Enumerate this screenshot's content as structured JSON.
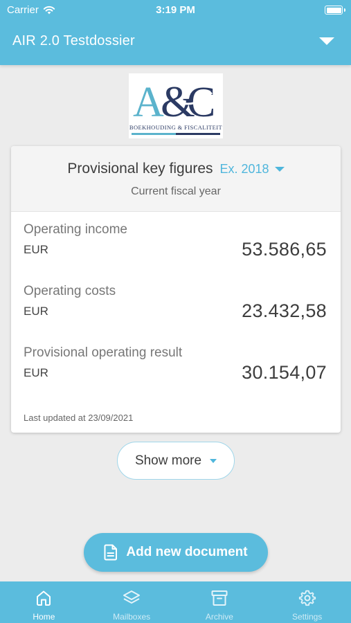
{
  "status_bar": {
    "carrier": "Carrier",
    "time": "3:19 PM"
  },
  "nav": {
    "title": "AIR 2.0 Testdossier"
  },
  "logo": {
    "text": "A&C",
    "subtitle": "Boekhouding & Fiscaliteit",
    "colors": {
      "teal": "#5bb3cc",
      "navy": "#2b3a63"
    }
  },
  "card": {
    "title": "Provisional key figures",
    "year": "Ex. 2018",
    "subtitle": "Current fiscal year",
    "figures": [
      {
        "label": "Operating income",
        "currency": "EUR",
        "value": "53.586,65"
      },
      {
        "label": "Operating costs",
        "currency": "EUR",
        "value": "23.432,58"
      },
      {
        "label": "Provisional operating result",
        "currency": "EUR",
        "value": "30.154,07"
      }
    ],
    "last_updated": "Last updated at 23/09/2021"
  },
  "show_more": {
    "label": "Show more"
  },
  "add_document": {
    "label": "Add new document"
  },
  "tabs": [
    {
      "label": "Home",
      "icon": "home-icon",
      "active": true
    },
    {
      "label": "Mailboxes",
      "icon": "layers-icon",
      "active": false
    },
    {
      "label": "Archive",
      "icon": "archive-icon",
      "active": false
    },
    {
      "label": "Settings",
      "icon": "gear-icon",
      "active": false
    }
  ],
  "colors": {
    "primary": "#5bbcdd",
    "accent": "#4fb6dc",
    "background": "#ececec"
  }
}
